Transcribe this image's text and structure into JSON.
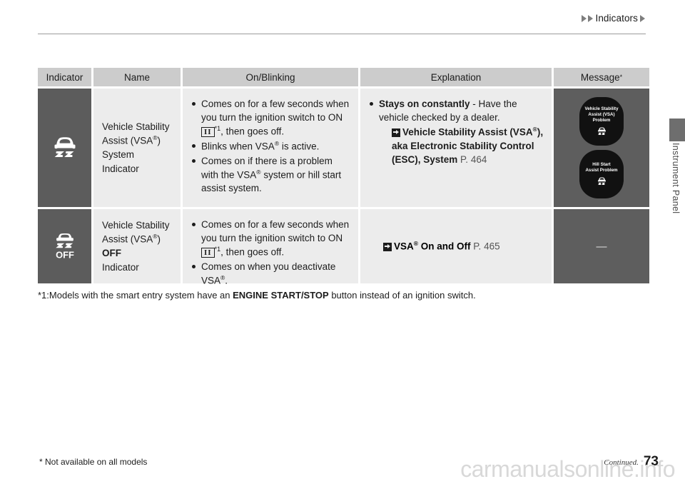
{
  "header": {
    "breadcrumb": "Indicators",
    "arrow_icon": "triangle-right-icon"
  },
  "side": {
    "section_label": "Instrument Panel"
  },
  "table": {
    "columns": [
      {
        "key": "indicator",
        "label": "Indicator"
      },
      {
        "key": "name",
        "label": "Name"
      },
      {
        "key": "onblinking",
        "label": "On/Blinking"
      },
      {
        "key": "explanation",
        "label": "Explanation"
      },
      {
        "key": "message",
        "label": "Message",
        "superscript": "*"
      }
    ],
    "rows": [
      {
        "indicator_icon": "vsa-skid-car-icon",
        "name_line1": "Vehicle Stability",
        "name_line2": "Assist (VSA",
        "name_reg": "®",
        "name_line2_end": ")",
        "name_line3": "System Indicator",
        "onblinking": [
          {
            "pre": "Comes on for a few seconds when you turn the ignition switch to ON",
            "glyph": "II",
            "glyph_sup": "*1",
            "post": ", then goes off."
          },
          {
            "pre": "Blinks when VSA",
            "reg": "®",
            "post": " is active."
          },
          {
            "pre": "Comes on if there is a problem with the VSA",
            "reg": "®",
            "post": " system or hill start assist system."
          }
        ],
        "explanation": {
          "bold_lead": "Stays on constantly",
          "rest": " - Have the vehicle checked by a dealer.",
          "reference": {
            "icon": "jump-to-reference-icon",
            "bold_text_1": "Vehicle Stability Assist (VSA",
            "reg": "®",
            "bold_text_2": "), aka Electronic Stability Control (ESC), System",
            "page": "P. 464"
          }
        },
        "message_pills": [
          {
            "text_lines": [
              "Vehicle Stability",
              "Assist (VSA)",
              "Problem"
            ],
            "icon": "vsa-skid-car-icon"
          },
          {
            "text_lines": [
              "Hill Start",
              "Assist Problem"
            ],
            "icon": "hill-start-assist-icon"
          }
        ]
      },
      {
        "indicator_icon": "vsa-off-icon",
        "name_line1": "Vehicle Stability",
        "name_line2": "Assist (VSA",
        "name_reg": "®",
        "name_line2_end": ") ",
        "name_bold": "OFF",
        "name_line3": "Indicator",
        "onblinking": [
          {
            "pre": "Comes on for a few seconds when you turn the ignition switch to ON",
            "glyph": "II",
            "glyph_sup": "*1",
            "post": ", then goes off."
          },
          {
            "pre": "Comes on when you deactivate VSA",
            "reg": "®",
            "post": "."
          }
        ],
        "explanation": {
          "reference": {
            "icon": "jump-to-reference-icon",
            "bold_text_1": "VSA",
            "reg": "®",
            "bold_text_2": " On and Off",
            "page": "P. 465"
          }
        },
        "message_dash": "—"
      }
    ]
  },
  "footnote": {
    "prefix": "*1:Models with the smart entry system have an ",
    "bold": "ENGINE START/STOP",
    "suffix": " button instead of an ignition switch."
  },
  "bottom": {
    "note": "* Not available on all models",
    "continued": "Continued.",
    "page_number": "73",
    "watermark": "carmanualsonline.info"
  },
  "colors": {
    "header_cell": "#cccccc",
    "indicator_cell": "#5c5c5c",
    "content_cell": "#ececec",
    "message_cell": "#5e5e5e",
    "pill": "#111111"
  }
}
